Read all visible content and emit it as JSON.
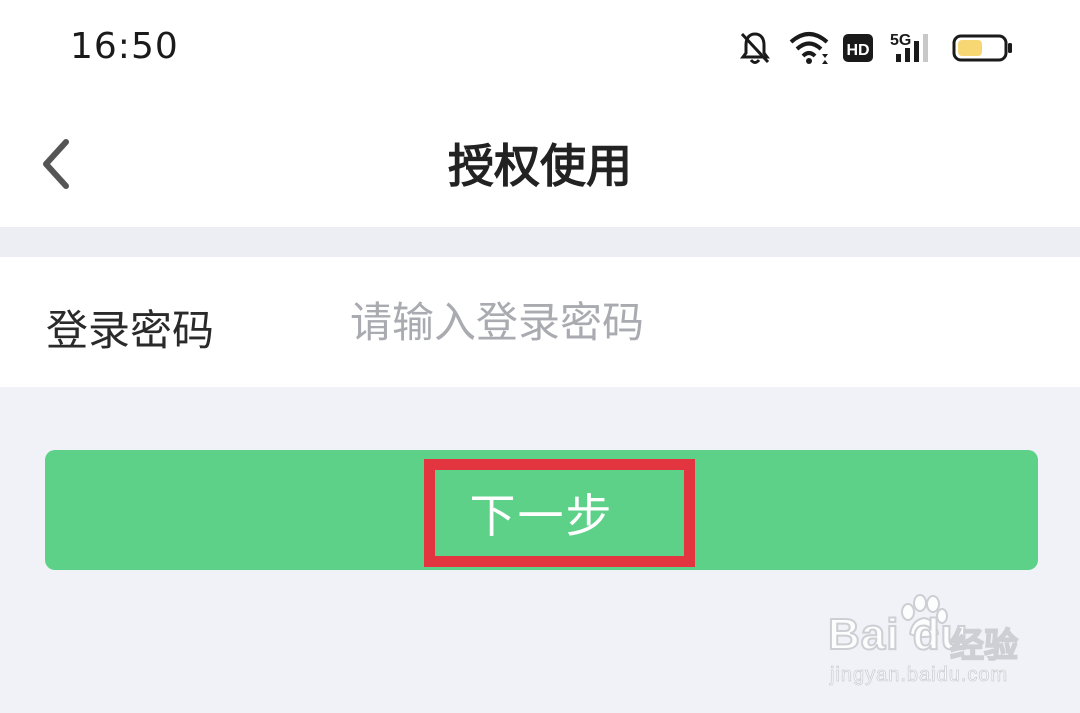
{
  "status_bar": {
    "time": "16:50",
    "icons": [
      "bell-off-icon",
      "wifi-icon",
      "hd-icon",
      "signal-5g-icon",
      "battery-icon"
    ],
    "hd_label": "HD",
    "network_label": "5G",
    "battery_color": "#f7d774"
  },
  "nav": {
    "back_icon": "chevron-left-icon",
    "title": "授权使用"
  },
  "form": {
    "password_label": "登录密码",
    "password_placeholder": "请输入登录密码",
    "password_value": ""
  },
  "actions": {
    "next_label": "下一步",
    "button_color": "#5ed189",
    "highlight_color": "#e3353f"
  },
  "watermark": {
    "brand": "Bai du",
    "sub": "经验",
    "url": "jingyan.baidu.com"
  }
}
